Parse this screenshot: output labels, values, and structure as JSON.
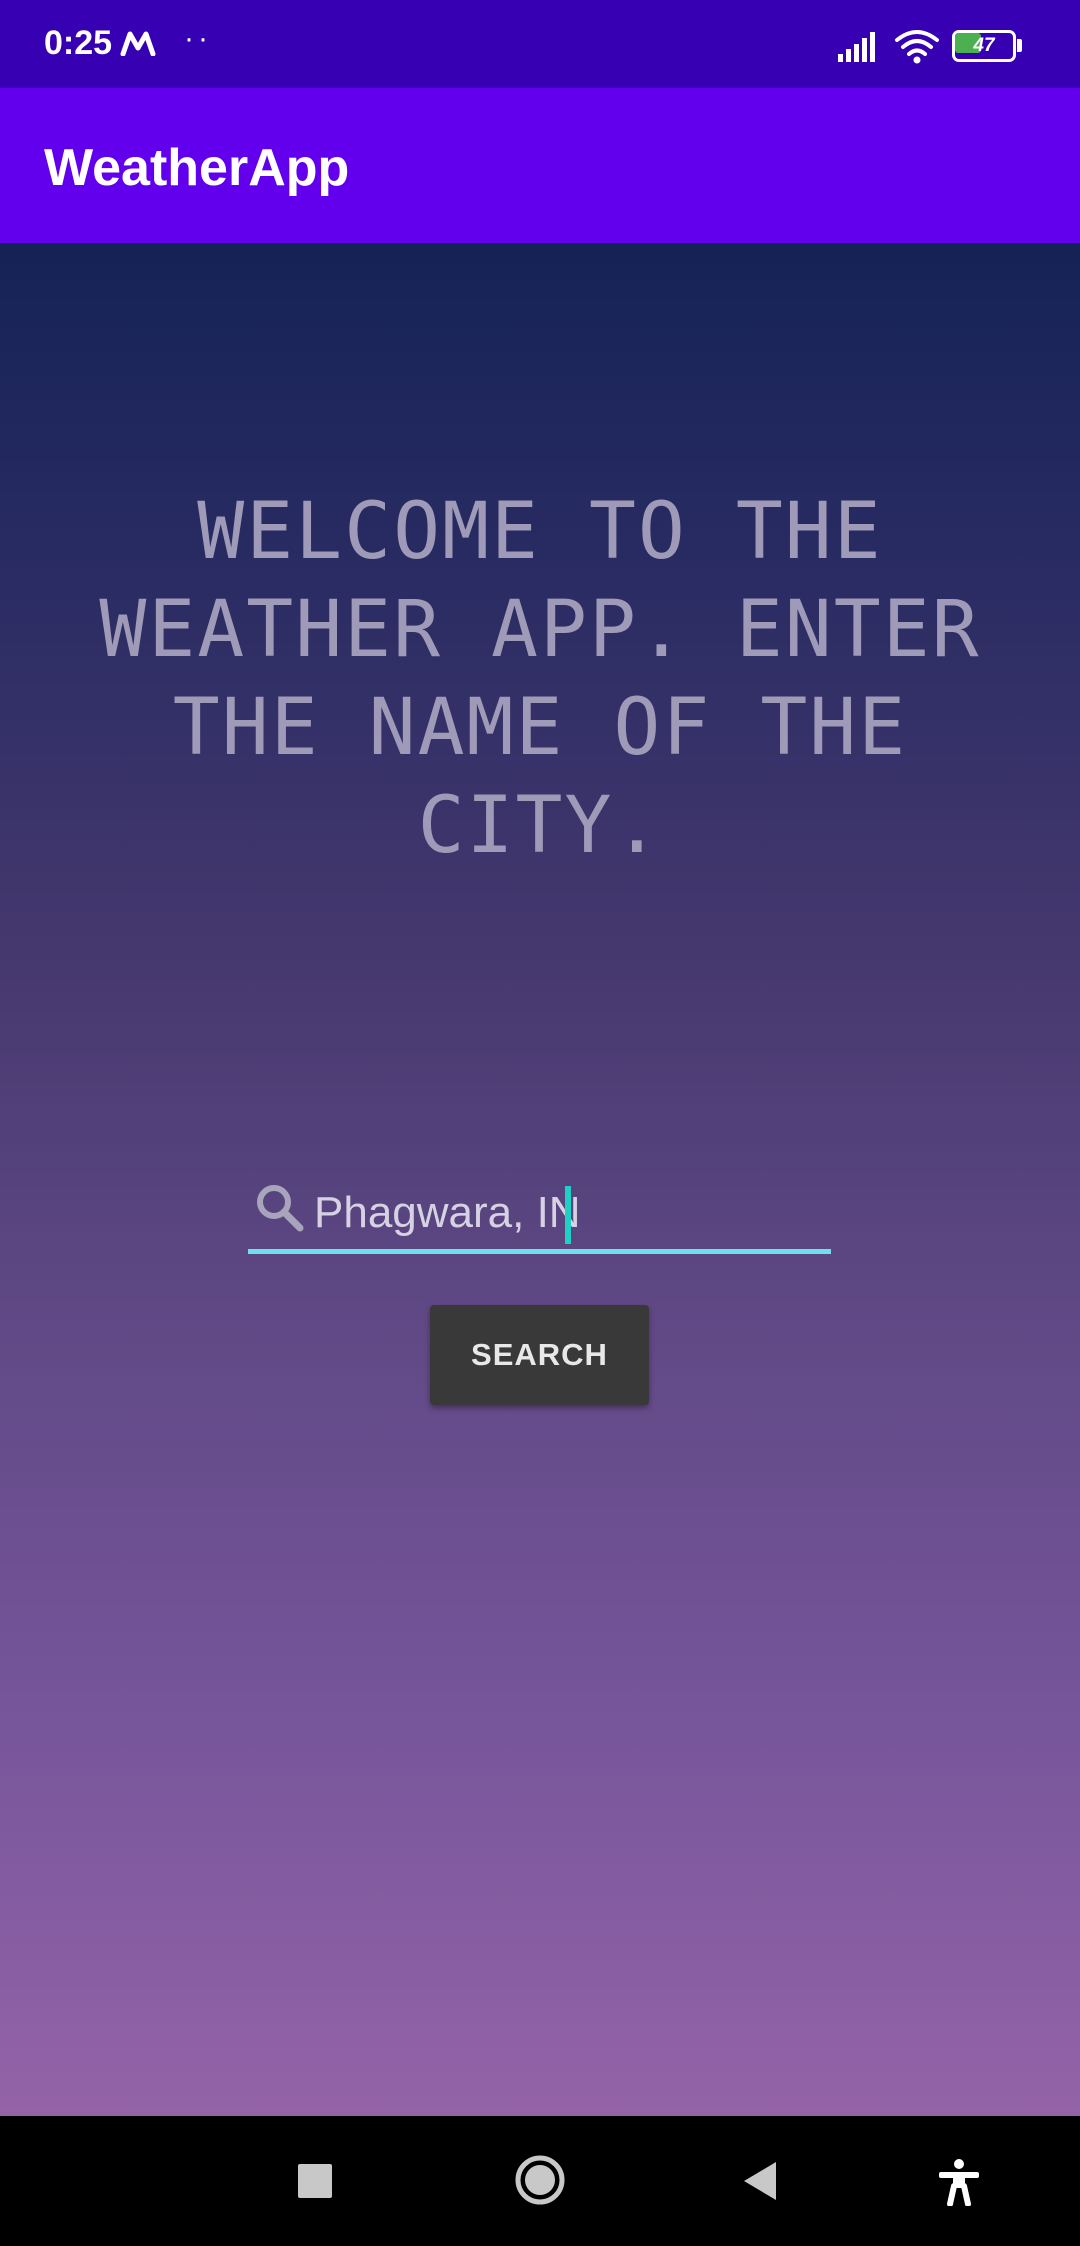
{
  "status_bar": {
    "time": "0:25",
    "dots": "··",
    "battery_level": "47",
    "icons": [
      "m-logo-icon",
      "signal-icon",
      "wifi-icon",
      "battery-icon"
    ]
  },
  "app_bar": {
    "title": "WeatherApp",
    "color": "#6200ee"
  },
  "main": {
    "welcome_text": "WELCOME TO THE WEATHER APP. ENTER THE NAME OF THE CITY.",
    "search": {
      "icon": "search-icon",
      "value": "Phagwara, IN",
      "accent_color": "#6fe0ef"
    },
    "search_button_label": "SEARCH"
  },
  "nav_bar": {
    "icons": [
      "recents-icon",
      "home-icon",
      "back-icon",
      "accessibility-icon"
    ]
  }
}
